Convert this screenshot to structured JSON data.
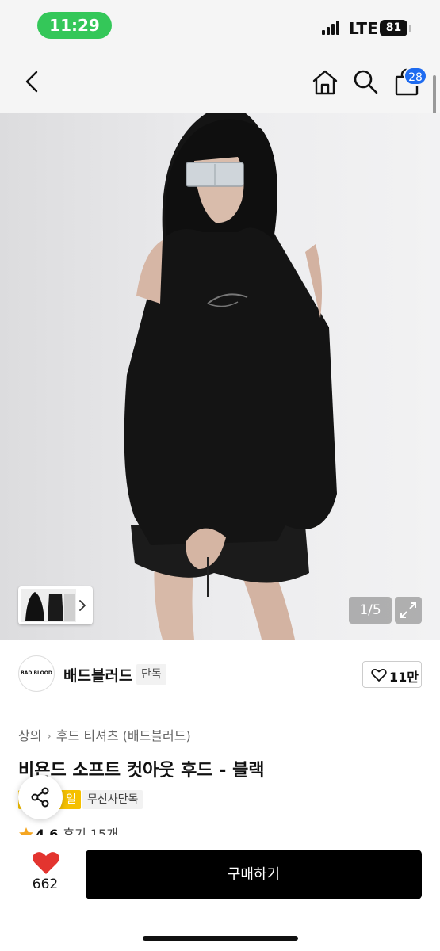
{
  "status_bar": {
    "time": "11:29",
    "network": "LTE",
    "battery": "81"
  },
  "nav": {
    "cart_count": "28",
    "icons": [
      "back-icon",
      "home-icon",
      "search-icon",
      "cart-icon"
    ]
  },
  "gallery": {
    "counter": "1/5"
  },
  "brand": {
    "logo_text": "BAD BLOOD",
    "name": "배드블러드",
    "tag": "단독",
    "likes": "11만"
  },
  "product": {
    "breadcrumb": [
      "상의",
      "후드 티셔츠 (배드블러드)"
    ],
    "title": "비욘드 소프트 컷아웃 후드 - 블랙",
    "badges": {
      "sale": "일",
      "exclusive": "무신사단독"
    },
    "rating": "4.6",
    "reviews": "후기 15개"
  },
  "bottom": {
    "heart_count": "662",
    "buy_label": "구매하기"
  },
  "colors": {
    "accent_badge": "#1e6bf0",
    "status_pill": "#34c759",
    "sale_badge": "#f5c000",
    "heart": "#e3342f",
    "buy_button": "#000000"
  }
}
